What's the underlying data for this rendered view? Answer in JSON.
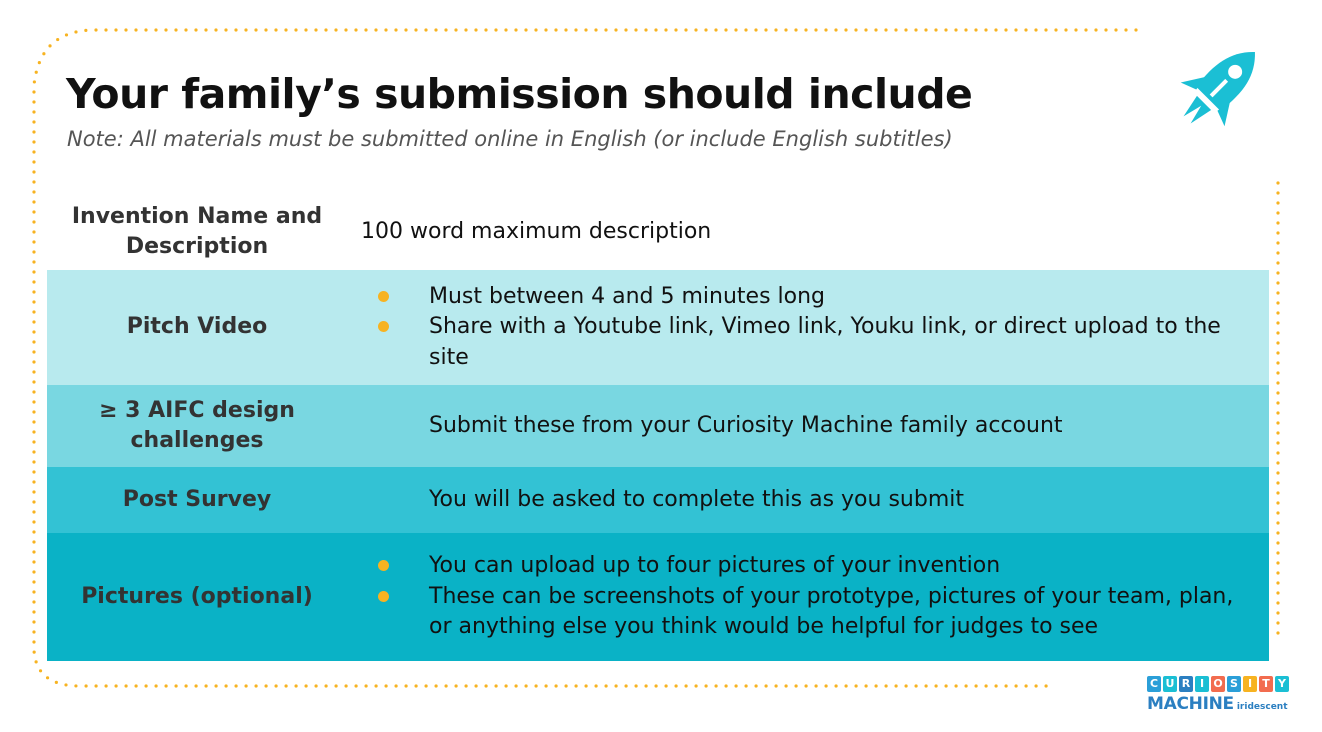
{
  "header": {
    "title": "Your family’s submission should include",
    "note": "Note: All materials must be submitted online in English (or include English subtitles)"
  },
  "table": {
    "rows": [
      {
        "label": "Invention Name and Description",
        "text": "100 word maximum description"
      },
      {
        "label": "Pitch Video",
        "bullets": [
          "Must between 4 and 5 minutes long",
          "Share with a Youtube link, Vimeo link, Youku link, or direct upload to the site"
        ]
      },
      {
        "label": "≥ 3 AIFC design challenges",
        "text": "Submit these from your Curiosity Machine family account"
      },
      {
        "label": "Post Survey",
        "text": "You will be asked to complete this as you submit"
      },
      {
        "label": "Pictures (optional)",
        "bullets": [
          "You can upload up to four pictures of your invention",
          "These can be screenshots of your prototype, pictures of your team, plan, or anything else you think would be helpful for judges to see"
        ]
      }
    ]
  },
  "logo": {
    "top_letters": [
      "C",
      "U",
      "R",
      "I",
      "O",
      "S",
      "I",
      "T",
      "Y"
    ],
    "main": "MACHINE",
    "sub": "iridescent"
  },
  "icons": {
    "rocket": "rocket-icon"
  },
  "colors": {
    "accent_teal": "#1bbfd4",
    "bullet": "#f7b321",
    "dots": "#f7b321",
    "row_2": "#b8eaee",
    "row_3": "#79d7e1",
    "row_4": "#33c2d4",
    "row_5": "#0ab2c6"
  }
}
